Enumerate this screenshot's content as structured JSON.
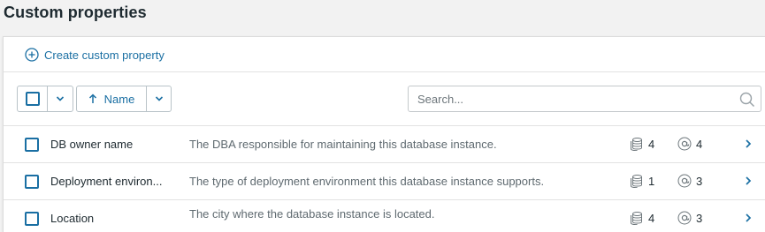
{
  "page": {
    "title": "Custom properties"
  },
  "actions": {
    "create_label": "Create custom property"
  },
  "toolbar": {
    "sort_label": "Name",
    "search_placeholder": "Search..."
  },
  "colors": {
    "accent": "#1a6fa3",
    "text": "#1e2a30",
    "muted": "#5f6a70"
  },
  "icons": {
    "create": "plus-circle-icon",
    "select_dropdown": "chevron-down-icon",
    "sort_direction": "arrow-up-icon",
    "search": "search-icon",
    "databases": "database-stack-icon",
    "instances": "at-sign-icon",
    "open": "chevron-right-icon"
  },
  "rows": [
    {
      "name": "DB owner name",
      "description": "The DBA responsible for maintaining this database instance.",
      "db_count": "4",
      "tag_count": "4"
    },
    {
      "name": "Deployment environ...",
      "description": "The type of deployment environment this database instance supports.",
      "db_count": "1",
      "tag_count": "3"
    },
    {
      "name": "Location",
      "description": "The city where the database instance is located.",
      "db_count": "4",
      "tag_count": "3"
    }
  ]
}
